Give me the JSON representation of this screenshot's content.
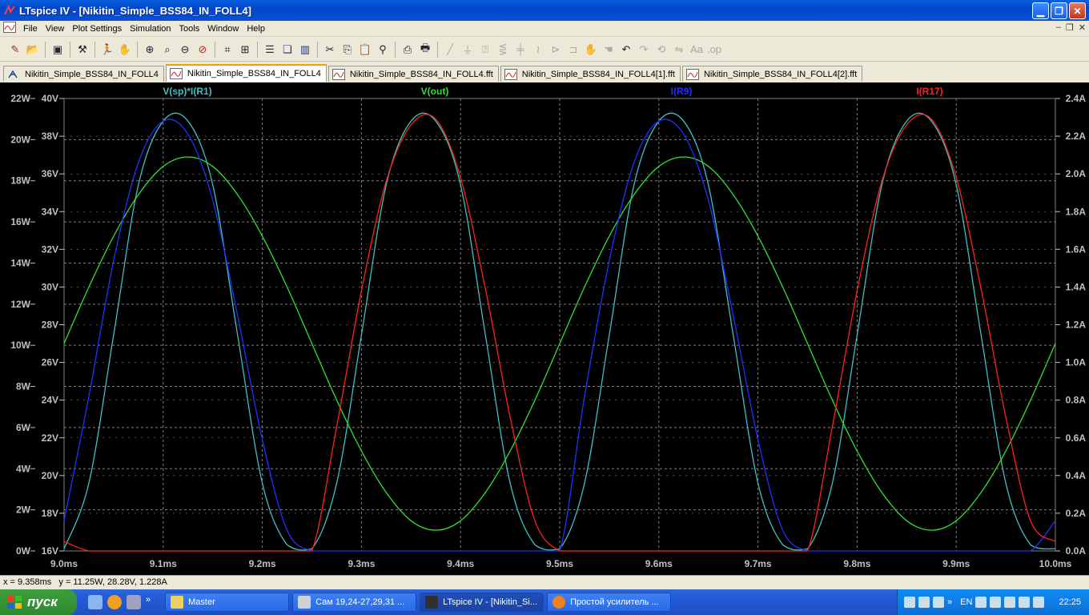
{
  "window": {
    "title": "LTspice IV - [Nikitin_Simple_BSS84_IN_FOLL4]"
  },
  "menu": {
    "items": [
      "File",
      "View",
      "Plot Settings",
      "Simulation",
      "Tools",
      "Window",
      "Help"
    ]
  },
  "tabs": [
    {
      "label": "Nikitin_Simple_BSS84_IN_FOLL4",
      "icon": "schematic-icon"
    },
    {
      "label": "Nikitin_Simple_BSS84_IN_FOLL4",
      "icon": "waveform-icon"
    },
    {
      "label": "Nikitin_Simple_BSS84_IN_FOLL4.fft",
      "icon": "waveform-icon"
    },
    {
      "label": "Nikitin_Simple_BSS84_IN_FOLL4[1].fft",
      "icon": "waveform-icon"
    },
    {
      "label": "Nikitin_Simple_BSS84_IN_FOLL4[2].fft",
      "icon": "waveform-icon"
    }
  ],
  "status": {
    "cursor": "x = 9.358ms   y = 11.25W, 28.28V, 1.228A"
  },
  "colors": {
    "trace_power": "#40c0c0",
    "trace_vout": "#30e030",
    "trace_ir9": "#2030ff",
    "trace_ir17": "#ff2020",
    "grid": "#808080",
    "axis_text": "#c0c0c0"
  },
  "chart_data": {
    "type": "line",
    "x_ticks": [
      "9.0ms",
      "9.1ms",
      "9.2ms",
      "9.3ms",
      "9.4ms",
      "9.5ms",
      "9.6ms",
      "9.7ms",
      "9.8ms",
      "9.9ms",
      "10.0ms"
    ],
    "y_left1_ticks": [
      "0W",
      "2W",
      "4W",
      "6W",
      "8W",
      "10W",
      "12W",
      "14W",
      "16W",
      "18W",
      "20W",
      "22W"
    ],
    "y_left2_ticks": [
      "16V",
      "18V",
      "20V",
      "22V",
      "24V",
      "26V",
      "28V",
      "30V",
      "32V",
      "34V",
      "36V",
      "38V",
      "40V"
    ],
    "y_right_ticks": [
      "0.0A",
      "0.2A",
      "0.4A",
      "0.6A",
      "0.8A",
      "1.0A",
      "1.2A",
      "1.4A",
      "1.6A",
      "1.8A",
      "2.0A",
      "2.2A",
      "2.4A"
    ],
    "xlim_ms": [
      9.0,
      10.0
    ],
    "ylim_W": [
      0,
      22
    ],
    "ylim_V": [
      16,
      40
    ],
    "ylim_A": [
      0,
      2.4
    ],
    "grid": true,
    "series": [
      {
        "name": "V(sp)*I(R1)",
        "axis": "W",
        "color": "#40c0c0",
        "x": [
          9.0,
          9.025,
          9.05,
          9.075,
          9.1,
          9.125,
          9.15,
          9.175,
          9.2,
          9.225,
          9.25,
          9.275,
          9.3,
          9.325,
          9.35,
          9.375,
          9.4,
          9.425,
          9.45,
          9.475,
          9.5,
          9.525,
          9.55,
          9.575,
          9.6,
          9.625,
          9.65,
          9.675,
          9.7,
          9.725,
          9.75,
          9.775,
          9.8,
          9.825,
          9.85,
          9.875,
          9.9,
          9.925,
          9.95,
          9.975,
          10.0
        ],
        "y": [
          0.1,
          3.3,
          10.5,
          17.8,
          20.9,
          20.9,
          17.8,
          10.5,
          3.3,
          0.3,
          0.1,
          3.3,
          10.5,
          17.8,
          20.9,
          20.9,
          17.8,
          10.5,
          3.3,
          0.3,
          0.1,
          3.3,
          10.5,
          17.8,
          20.9,
          20.9,
          17.8,
          10.5,
          3.3,
          0.3,
          0.1,
          3.3,
          10.5,
          17.8,
          20.9,
          20.9,
          17.8,
          10.5,
          3.3,
          0.3,
          0.1
        ]
      },
      {
        "name": "V(out)",
        "axis": "V",
        "color": "#30e030",
        "x": [
          9.0,
          9.025,
          9.05,
          9.075,
          9.1,
          9.125,
          9.15,
          9.175,
          9.2,
          9.225,
          9.25,
          9.275,
          9.3,
          9.325,
          9.35,
          9.375,
          9.4,
          9.425,
          9.45,
          9.475,
          9.5,
          9.525,
          9.55,
          9.575,
          9.6,
          9.625,
          9.65,
          9.675,
          9.7,
          9.725,
          9.75,
          9.775,
          9.8,
          9.825,
          9.85,
          9.875,
          9.9,
          9.925,
          9.95,
          9.975,
          10.0
        ],
        "y": [
          27.0,
          30.0,
          32.7,
          34.9,
          36.4,
          36.9,
          36.4,
          34.9,
          32.7,
          30.0,
          27.0,
          24.0,
          21.3,
          19.1,
          17.6,
          17.1,
          17.6,
          19.1,
          21.3,
          24.0,
          27.0,
          30.0,
          32.7,
          34.9,
          36.4,
          36.9,
          36.4,
          34.9,
          32.7,
          30.0,
          27.0,
          24.0,
          21.3,
          19.1,
          17.6,
          17.1,
          17.6,
          19.1,
          21.3,
          24.0,
          27.0
        ]
      },
      {
        "name": "I(R9)",
        "axis": "A",
        "color": "#2030ff",
        "x": [
          9.0,
          9.025,
          9.05,
          9.075,
          9.1,
          9.125,
          9.15,
          9.175,
          9.2,
          9.225,
          9.25,
          9.275,
          9.3,
          9.325,
          9.35,
          9.375,
          9.4,
          9.425,
          9.45,
          9.475,
          9.5,
          9.525,
          9.55,
          9.575,
          9.6,
          9.625,
          9.65,
          9.675,
          9.7,
          9.725,
          9.75,
          9.775,
          9.8,
          9.825,
          9.85,
          9.875,
          9.9,
          9.925,
          9.95,
          9.975,
          10.0
        ],
        "y": [
          0.16,
          0.82,
          1.54,
          2.06,
          2.28,
          2.21,
          1.86,
          1.25,
          0.59,
          0.11,
          0.0,
          0.0,
          0.0,
          0.0,
          0.0,
          0.0,
          0.0,
          0.0,
          0.0,
          0.0,
          0.0,
          0.82,
          1.54,
          2.06,
          2.28,
          2.21,
          1.86,
          1.25,
          0.59,
          0.11,
          0.0,
          0.0,
          0.0,
          0.0,
          0.0,
          0.0,
          0.0,
          0.0,
          0.0,
          0.0,
          0.16
        ]
      },
      {
        "name": "I(R17)",
        "axis": "A",
        "color": "#ff2020",
        "x": [
          9.0,
          9.025,
          9.05,
          9.075,
          9.1,
          9.125,
          9.15,
          9.175,
          9.2,
          9.225,
          9.25,
          9.275,
          9.3,
          9.325,
          9.35,
          9.375,
          9.4,
          9.425,
          9.45,
          9.475,
          9.5,
          9.525,
          9.55,
          9.575,
          9.6,
          9.625,
          9.65,
          9.675,
          9.7,
          9.725,
          9.75,
          9.775,
          9.8,
          9.825,
          9.85,
          9.875,
          9.9,
          9.925,
          9.95,
          9.975,
          10.0
        ],
        "y": [
          0.05,
          0.0,
          0.0,
          0.0,
          0.0,
          0.0,
          0.0,
          0.0,
          0.0,
          0.0,
          0.0,
          0.66,
          1.38,
          1.96,
          2.26,
          2.29,
          1.98,
          1.39,
          0.71,
          0.16,
          0.0,
          0.0,
          0.0,
          0.0,
          0.0,
          0.0,
          0.0,
          0.0,
          0.0,
          0.0,
          0.0,
          0.66,
          1.38,
          1.96,
          2.26,
          2.29,
          1.98,
          1.39,
          0.71,
          0.16,
          0.05
        ]
      }
    ]
  },
  "taskbar": {
    "start_label": "пуск",
    "tasks": [
      "Master",
      "Сам 19,24-27,29,31 ...",
      "LTspice IV - [Nikitin_Si...",
      "Простой усилитель ..."
    ],
    "lang": "EN",
    "clock": "22:25"
  }
}
